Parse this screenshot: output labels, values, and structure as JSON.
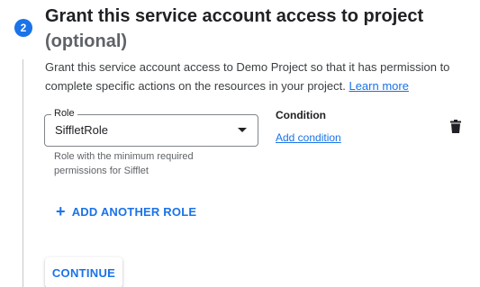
{
  "step": {
    "number": "2",
    "title": "Grant this service account access to project",
    "subtitle": "(optional)"
  },
  "description": {
    "text": "Grant this service account access to Demo Project so that it has permission to complete specific actions on the resources in your project.",
    "link_label": "Learn more"
  },
  "role": {
    "label": "Role",
    "value": "SiffletRole",
    "hint": "Role with the minimum required permissions for Sifflet"
  },
  "condition": {
    "label": "Condition",
    "link_label": "Add condition"
  },
  "actions": {
    "add_role_label": "ADD ANOTHER ROLE",
    "continue_label": "CONTINUE"
  },
  "colors": {
    "accent": "#1a73e8",
    "text": "#202124",
    "muted": "#5f6368"
  },
  "icons": [
    "trash-icon",
    "dropdown-arrow-icon",
    "plus-icon"
  ]
}
